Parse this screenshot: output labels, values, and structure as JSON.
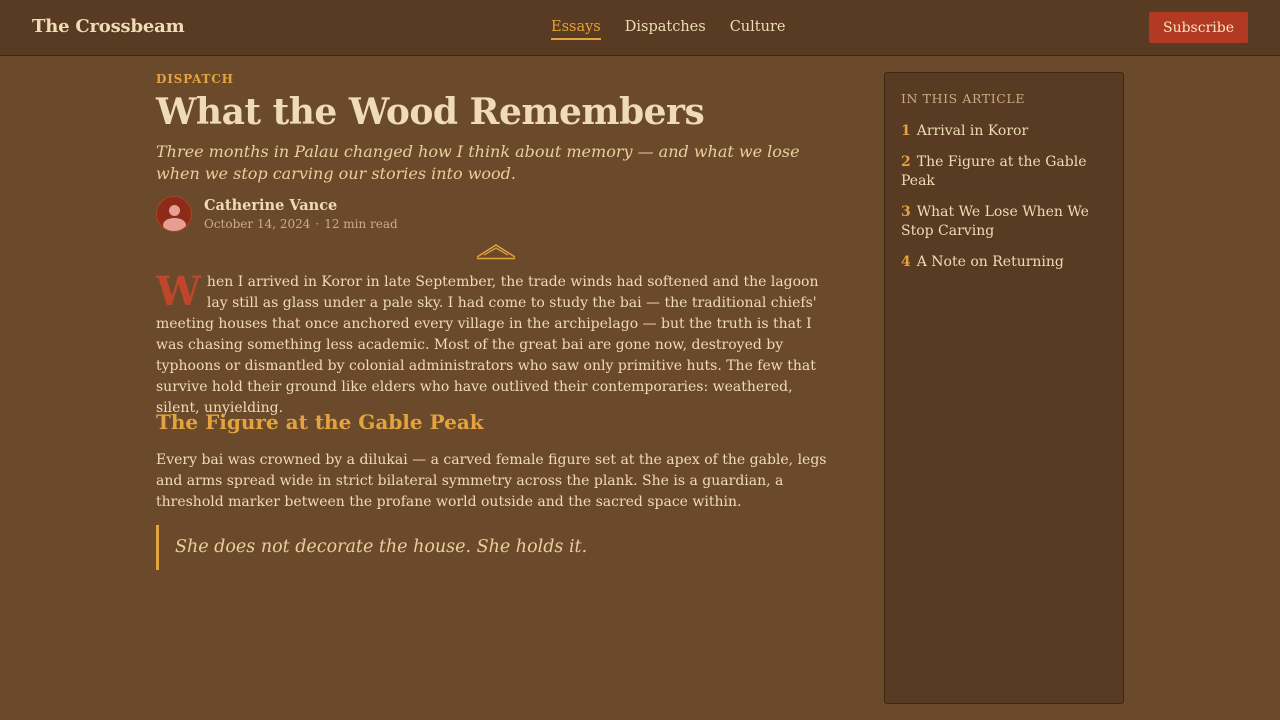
{
  "header": {
    "brand": "The Crossbeam",
    "nav": [
      {
        "label": "Essays",
        "active": true
      },
      {
        "label": "Dispatches",
        "active": false
      },
      {
        "label": "Culture",
        "active": false
      }
    ],
    "subscribe_label": "Subscribe"
  },
  "article": {
    "kicker": "DISPATCH",
    "title": "What the Wood Remembers",
    "dek": "Three months in Palau changed how I think about memory — and what we lose when we stop carving our stories into wood.",
    "author": "Catherine Vance",
    "date": "October 14, 2024",
    "separator": "·",
    "read_time": "12 min read",
    "dropcap": "W",
    "paragraph1": "hen I arrived in Koror in late September, the trade winds had softened and the lagoon lay still as glass under a pale sky. I had come to study the bai — the traditional chiefs' meeting houses that once anchored every village in the archipelago — but the truth is that I was chasing something less academic. Most of the great bai are gone now, destroyed by typhoons or dismantled by colonial administrators who saw only primitive huts. The few that survive hold their ground like elders who have outlived their contemporaries: weathered, silent, unyielding.",
    "heading2": "The Figure at the Gable Peak",
    "paragraph2": "Every bai was crowned by a dilukai — a carved female figure set at the apex of the gable, legs and arms spread wide in strict bilateral symmetry across the plank. She is a guardian, a threshold marker between the profane world outside and the sacred space within.",
    "pullquote": "She does not decorate the house. She holds it."
  },
  "toc": {
    "title": "IN THIS ARTICLE",
    "items": [
      {
        "num": "1",
        "label": "Arrival in Koror"
      },
      {
        "num": "2",
        "label": "The Figure at the Gable Peak"
      },
      {
        "num": "3",
        "label": "What We Lose When We Stop Carving"
      },
      {
        "num": "4",
        "label": "A Note on Returning"
      }
    ]
  },
  "colors": {
    "background": "#6b4a2b",
    "header": "#583b22",
    "accent": "#e3a33e",
    "subscribe": "#b33a22",
    "text": "#efdcb6"
  },
  "icons": {
    "avatar": "user-avatar-icon",
    "ornament": "gable-roof-ornament-icon"
  }
}
